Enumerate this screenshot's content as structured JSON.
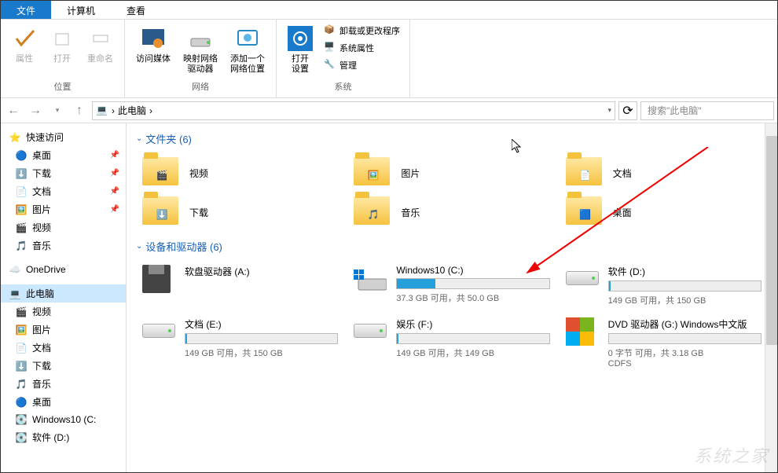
{
  "tabs": {
    "file": "文件",
    "computer": "计算机",
    "view": "查看"
  },
  "ribbon": {
    "group_location": {
      "label": "位置",
      "properties": "属性",
      "open": "打开",
      "rename": "重命名"
    },
    "group_network": {
      "label": "网络",
      "access_media": "访问媒体",
      "map_drive": "映射网络\n驱动器",
      "add_location": "添加一个\n网络位置"
    },
    "group_system": {
      "label": "系统",
      "open_settings": "打开\n设置",
      "uninstall": "卸载或更改程序",
      "sys_props": "系统属性",
      "manage": "管理"
    }
  },
  "nav": {
    "location_root": "此电脑",
    "sep": "›",
    "search_placeholder": "搜索\"此电脑\""
  },
  "sidebar": {
    "quick_access": "快速访问",
    "desktop": "桌面",
    "downloads": "下载",
    "documents": "文档",
    "pictures": "图片",
    "videos": "视频",
    "music": "音乐",
    "onedrive": "OneDrive",
    "this_pc": "此电脑",
    "win10c": "Windows10 (C:",
    "soft_d": "软件 (D:)"
  },
  "sections": {
    "folders": "文件夹 (6)",
    "drives": "设备和驱动器 (6)"
  },
  "folders": [
    {
      "name": "视频",
      "overlay": "video"
    },
    {
      "name": "图片",
      "overlay": "picture"
    },
    {
      "name": "文档",
      "overlay": "document"
    },
    {
      "name": "下载",
      "overlay": "download"
    },
    {
      "name": "音乐",
      "overlay": "music"
    },
    {
      "name": "桌面",
      "overlay": "desktop"
    }
  ],
  "drives": [
    {
      "name": "软盘驱动器 (A:)",
      "type": "floppy",
      "stats": "",
      "fill": 0
    },
    {
      "name": "Windows10 (C:)",
      "type": "hdd-win",
      "stats": "37.3 GB 可用，共 50.0 GB",
      "fill": 25
    },
    {
      "name": "软件 (D:)",
      "type": "hdd",
      "stats": "149 GB 可用，共 150 GB",
      "fill": 1
    },
    {
      "name": "文档 (E:)",
      "type": "hdd",
      "stats": "149 GB 可用，共 150 GB",
      "fill": 1
    },
    {
      "name": "娱乐 (F:)",
      "type": "hdd",
      "stats": "149 GB 可用，共 149 GB",
      "fill": 1
    },
    {
      "name": "DVD 驱动器 (G:) Windows中文版",
      "type": "dvd",
      "stats": "0 字节 可用，共 3.18 GB",
      "extra": "CDFS",
      "fill": 0
    }
  ],
  "colors": {
    "accent": "#1979ca",
    "barfill": "#26a0da"
  },
  "watermark": "系统之家"
}
